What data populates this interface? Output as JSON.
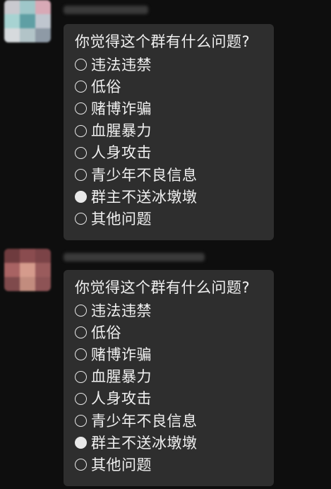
{
  "messages": [
    {
      "poll": {
        "question": "你觉得这个群有什么问题?",
        "options": [
          {
            "label": "违法违禁",
            "selected": false
          },
          {
            "label": "低俗",
            "selected": false
          },
          {
            "label": "赌博诈骗",
            "selected": false
          },
          {
            "label": "血腥暴力",
            "selected": false
          },
          {
            "label": "人身攻击",
            "selected": false
          },
          {
            "label": "青少年不良信息",
            "selected": false
          },
          {
            "label": "群主不送冰墩墩",
            "selected": true
          },
          {
            "label": "其他问题",
            "selected": false
          }
        ]
      }
    },
    {
      "poll": {
        "question": "你觉得这个群有什么问题?",
        "options": [
          {
            "label": "违法违禁",
            "selected": false
          },
          {
            "label": "低俗",
            "selected": false
          },
          {
            "label": "赌博诈骗",
            "selected": false
          },
          {
            "label": "血腥暴力",
            "selected": false
          },
          {
            "label": "人身攻击",
            "selected": false
          },
          {
            "label": "青少年不良信息",
            "selected": false
          },
          {
            "label": "群主不送冰墩墩",
            "selected": true
          },
          {
            "label": "其他问题",
            "selected": false
          }
        ]
      }
    }
  ],
  "colors": {
    "background": "#0e0e0e",
    "bubble": "#2e2e2e",
    "text": "#f0f0f0",
    "radio": "#e8e8e8"
  }
}
